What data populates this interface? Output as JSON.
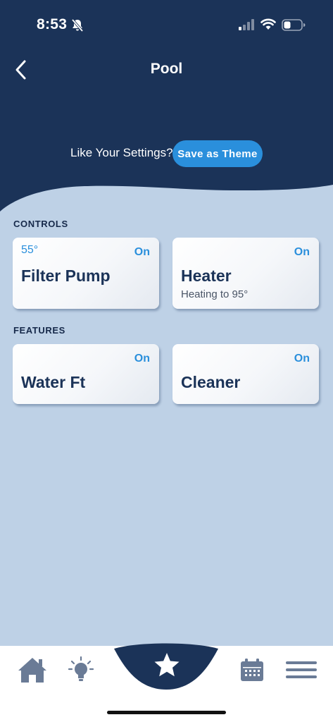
{
  "status_bar": {
    "time": "8:53",
    "icons": [
      "bell-slash-icon",
      "signal-icon",
      "wifi-icon",
      "battery-icon"
    ]
  },
  "header": {
    "title": "Pool",
    "back_icon": "chevron-left-icon",
    "theme_prompt": "Like Your Settings?",
    "save_theme_label": "Save as Theme"
  },
  "controls": {
    "section_title": "CONTROLS",
    "cards": [
      {
        "temperature": "55°",
        "status": "On",
        "name": "Filter Pump",
        "detail": ""
      },
      {
        "temperature": "",
        "status": "On",
        "name": "Heater",
        "detail": "Heating to 95°"
      }
    ]
  },
  "features": {
    "section_title": "FEATURES",
    "cards": [
      {
        "status": "On",
        "name": "Water Ft"
      },
      {
        "status": "On",
        "name": "Cleaner"
      }
    ]
  },
  "tab_bar": {
    "tabs": [
      {
        "icon": "home-icon"
      },
      {
        "icon": "lightbulb-icon"
      },
      {
        "icon": "star-icon",
        "active": true
      },
      {
        "icon": "calendar-icon"
      },
      {
        "icon": "menu-icon"
      }
    ]
  },
  "colors": {
    "header_bg": "#1b3358",
    "page_bg": "#bed1e6",
    "accent": "#2a8fdc",
    "card_text": "#1b3358"
  }
}
